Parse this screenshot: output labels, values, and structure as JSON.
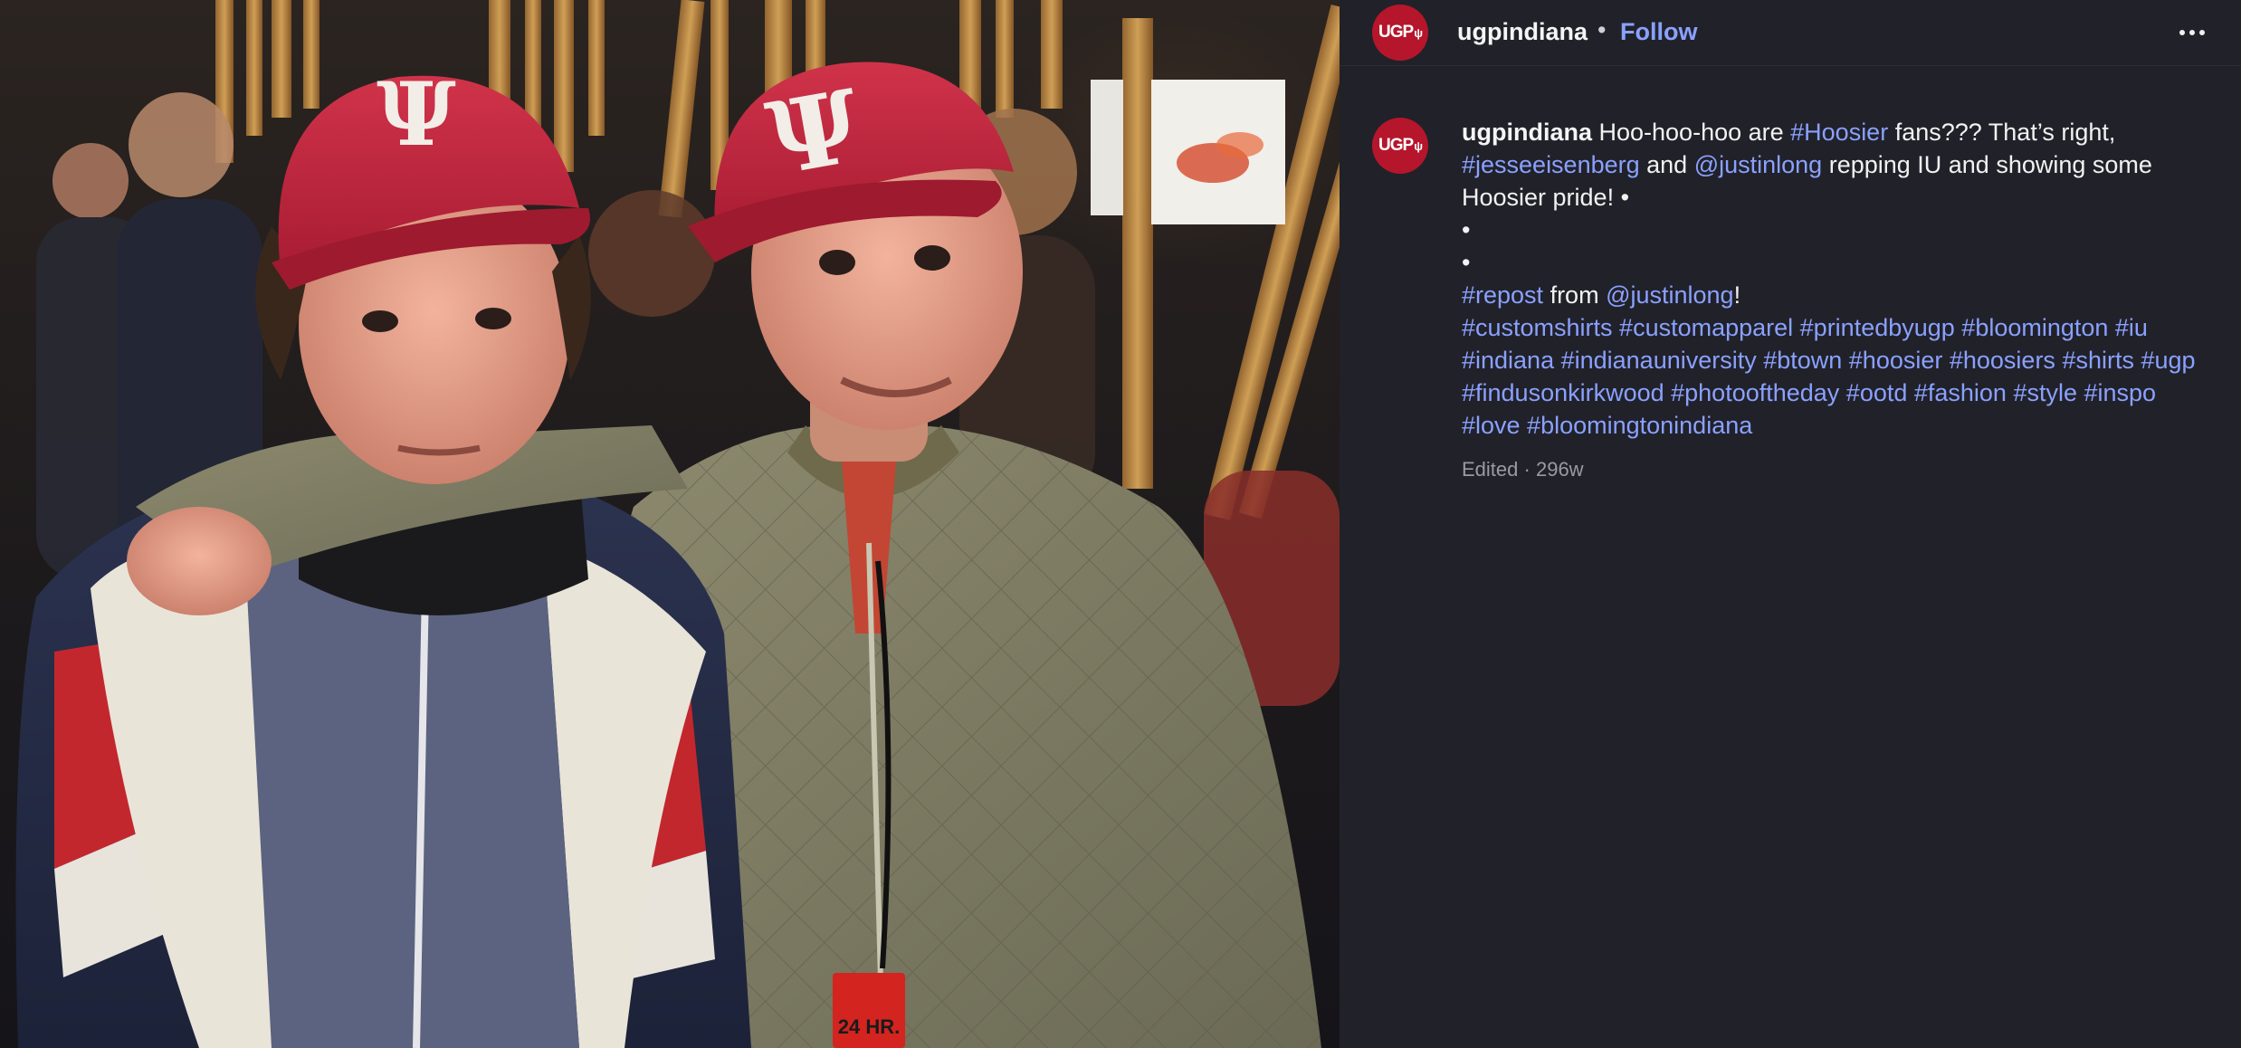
{
  "header": {
    "avatar_text": "UGP",
    "avatar_mark": "ψ",
    "username": "ugpindiana",
    "separator": "•",
    "follow_label": "Follow",
    "more_icon": "more-horizontal-icon"
  },
  "photo": {
    "description_icon": "photo",
    "cap_logo": "Ψ",
    "badge_text": "24 HR."
  },
  "caption": {
    "username": "ugpindiana",
    "line1_text_a": " Hoo-hoo-hoo are ",
    "line1_tag": "#Hoosier",
    "line1_text_b": " fans??? That’s right, ",
    "line2_tag_a": "#jesseeisenberg",
    "line2_text_a": " and ",
    "line2_tag_b": "@justinlong",
    "line2_text_b": " repping IU and showing some Hoosier pride! •",
    "bullet_1": "•",
    "bullet_2": "•",
    "repost_tag": "#repost",
    "repost_text": " from ",
    "repost_user": "@justinlong",
    "repost_end": "!",
    "hashtags": "#customshirts #customapparel #printedbyugp #bloomington #iu #indiana #indianauniversity #btown #hoosier #hoosiers #shirts #ugp #findusonkirkwood #photooftheday #ootd #fashion #style #inspo #love #bloomingtonindiana"
  },
  "meta": {
    "edited_label": "Edited",
    "dot": "·",
    "age": "296w"
  },
  "colors": {
    "background": "#212129",
    "link": "#8aa1ff",
    "brand_red": "#b5162b",
    "muted": "#9a9aa3"
  }
}
